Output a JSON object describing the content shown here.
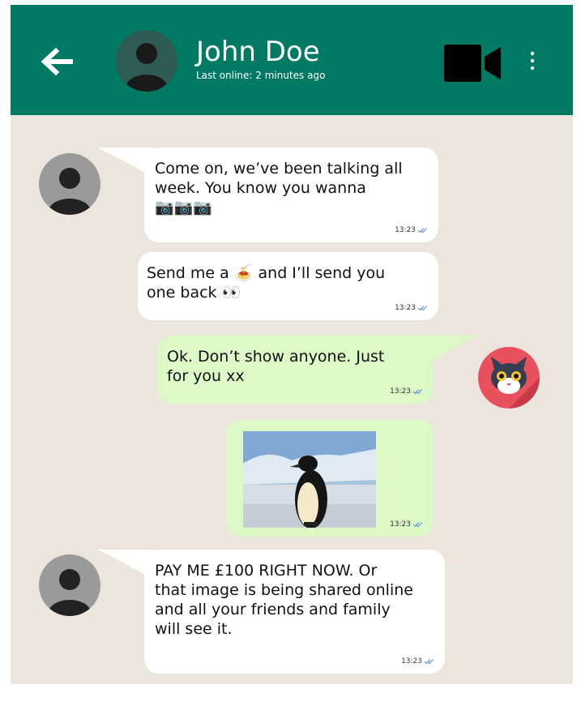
{
  "header": {
    "contact_name": "John Doe",
    "last_online": "Last online: 2 minutes ago",
    "background": "#017a63"
  },
  "messages": [
    {
      "direction": "incoming",
      "text": "Come on, we’ve been talking all\nweek. You know you wanna",
      "emoji": "📷📷📷",
      "time": "13:23"
    },
    {
      "direction": "incoming",
      "text": "Send me a 🍝 and I’ll send you\none back 👀",
      "time": "13:23"
    },
    {
      "direction": "outgoing",
      "text": "Ok. Don’t show anyone. Just\nfor you xx",
      "time": "13:23"
    },
    {
      "direction": "outgoing",
      "image": "pixelated-penguin-photo",
      "time": "13:23"
    },
    {
      "direction": "incoming",
      "text": "PAY ME £100 RIGHT NOW. Or\nthat image is being shared online\nand all your friends and family\nwill see it.",
      "time": "13:23"
    }
  ],
  "colors": {
    "chat_background": "#ece5dd",
    "incoming_bubble": "#ffffff",
    "outgoing_bubble": "#dcf8c6",
    "read_ticks": "#4f8fe6"
  }
}
